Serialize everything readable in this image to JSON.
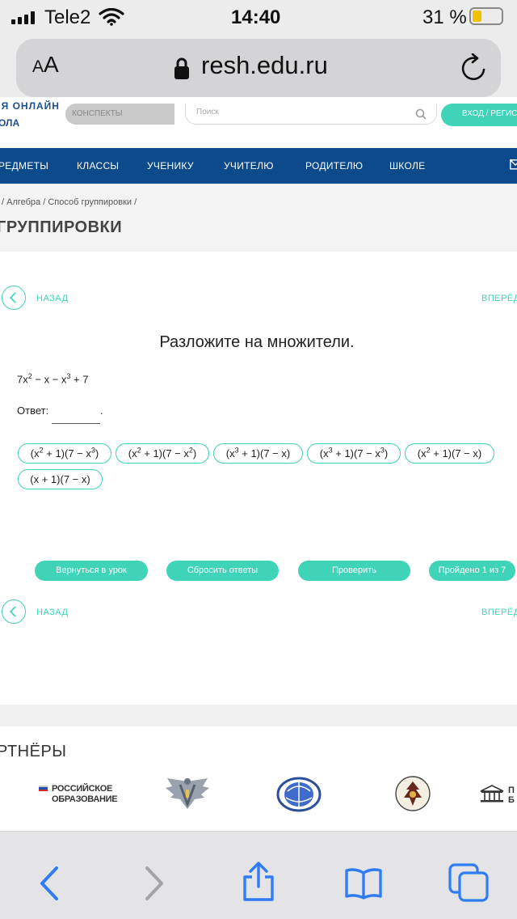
{
  "status_bar": {
    "carrier": "Tele2",
    "time": "14:40",
    "battery": "31 %"
  },
  "address_bar": {
    "aa_small": "A",
    "aa_large": "A",
    "url": "resh.edu.ru"
  },
  "site_header": {
    "logo_line1": "ЯЯ ОНЛАЙН",
    "logo_line2": "ОЛА",
    "konspekty_tab": "КОНСПЕКТЫ",
    "search_placeholder": "Поиск",
    "login_label": "ВХОД / РЕГИСТР"
  },
  "nav": {
    "items": [
      "РЕДМЕТЫ",
      "КЛАССЫ",
      "УЧЕНИКУ",
      "УЧИТЕЛЮ",
      "РОДИТЕЛЮ",
      "ШКОЛЕ"
    ]
  },
  "breadcrumb": "/  Алгебра  /  Способ группировки  /",
  "page_title": "ГРУППИРОВКИ",
  "card": {
    "back_label": "НАЗАД",
    "forward_label": "ВПЕРЁД",
    "task_title": "Разложите на множители.",
    "expression": {
      "a": "7x",
      "a_exp": "2",
      "b": " − x − x",
      "b_exp": "3",
      "c": " + 7"
    },
    "answer_label": "Ответ:",
    "answer_dot": ".",
    "options": [
      {
        "p1": "(x",
        "e1": "2",
        "p2": " + 1)(7 − x",
        "e2": "3",
        "p3": ")"
      },
      {
        "p1": "(x",
        "e1": "2",
        "p2": " + 1)(7 − x",
        "e2": "2",
        "p3": ")"
      },
      {
        "p1": "(x",
        "e1": "3",
        "p2": " + 1)(7 − x)",
        "e2": "",
        "p3": ""
      },
      {
        "p1": "(x",
        "e1": "3",
        "p2": " + 1)(7 − x",
        "e2": "3",
        "p3": ")"
      },
      {
        "p1": "(x",
        "e1": "2",
        "p2": " + 1)(7 − x)",
        "e2": "",
        "p3": ""
      },
      {
        "p1": "(x + 1)(7 − x)",
        "e1": "",
        "p2": "",
        "e2": "",
        "p3": ""
      }
    ],
    "buttons": {
      "return": "Вернуться в урок",
      "reset": "Сбросить ответы",
      "check": "Проверить",
      "progress": "Пройдено 1 из 7"
    }
  },
  "partners": {
    "title": "РТНЁРЫ",
    "rus_edu_line1": "РОССИЙСКОЕ",
    "rus_edu_line2": "ОБРАЗОВАНИЕ",
    "last_partial": "П Б"
  },
  "colors": {
    "accent": "#3fd3b8",
    "nav_blue": "#0c4a8c",
    "ios_blue": "#2f7cf6"
  }
}
